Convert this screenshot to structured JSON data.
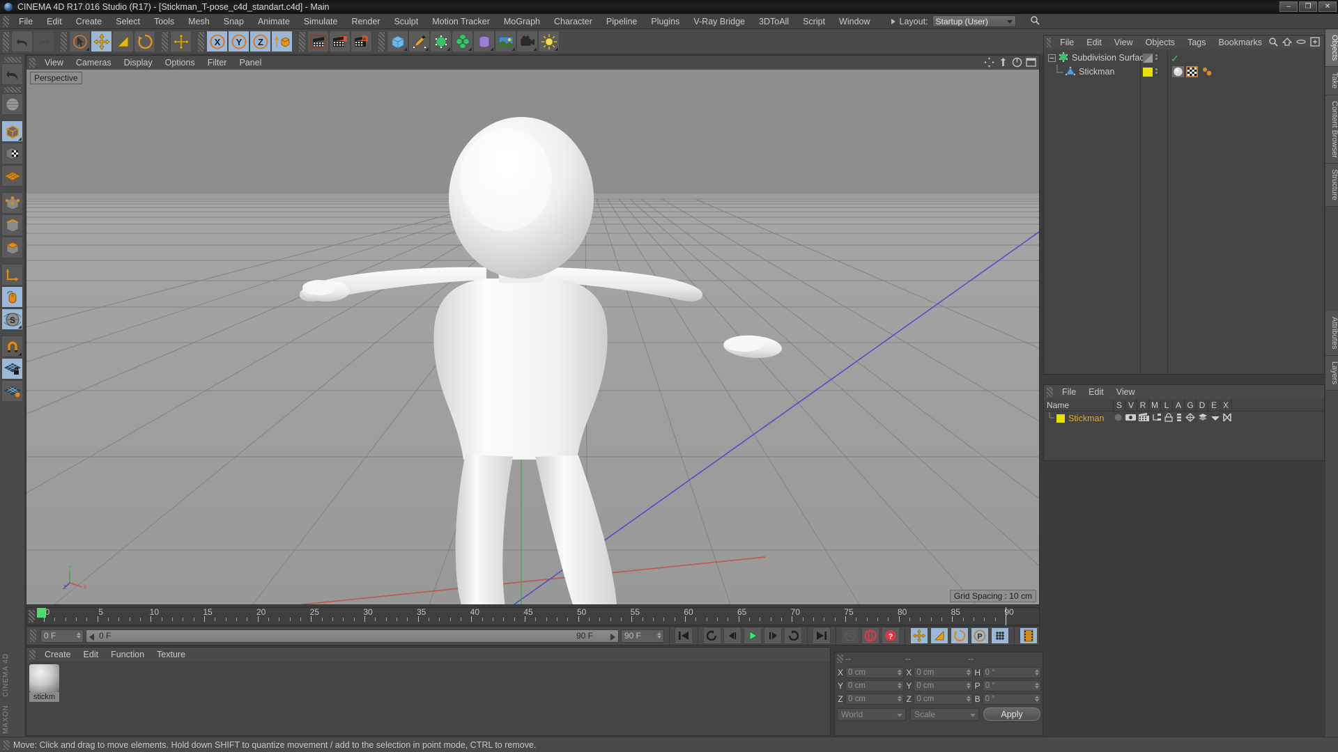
{
  "window": {
    "title": "CINEMA 4D R17.016 Studio (R17) - [Stickman_T-pose_c4d_standart.c4d] - Main",
    "minimize": "–",
    "maximize": "❐",
    "close": "✕"
  },
  "menubar": {
    "items": [
      "File",
      "Edit",
      "Create",
      "Select",
      "Tools",
      "Mesh",
      "Snap",
      "Animate",
      "Simulate",
      "Render",
      "Sculpt",
      "Motion Tracker",
      "MoGraph",
      "Character",
      "Pipeline",
      "Plugins",
      "V-Ray Bridge",
      "3DToAll",
      "Script",
      "Window"
    ],
    "layout_label": "Layout:",
    "layout_value": "Startup (User)"
  },
  "toolbar": {
    "groups": [
      {
        "buttons": [
          {
            "name": "undo-icon",
            "state": "normal"
          },
          {
            "name": "redo-icon",
            "state": "disabled"
          }
        ]
      },
      {
        "buttons": [
          {
            "name": "live-selection-icon",
            "state": "normal"
          },
          {
            "name": "move-tool-icon",
            "state": "selected"
          },
          {
            "name": "scale-tool-icon",
            "state": "normal"
          },
          {
            "name": "rotate-tool-icon",
            "state": "normal"
          }
        ]
      },
      {
        "buttons": [
          {
            "name": "move-axis-icon",
            "state": "normal"
          }
        ]
      },
      {
        "buttons": [
          {
            "name": "x-axis-lock-icon",
            "state": "selected"
          },
          {
            "name": "y-axis-lock-icon",
            "state": "selected"
          },
          {
            "name": "z-axis-lock-icon",
            "state": "selected"
          },
          {
            "name": "world-object-axis-icon",
            "state": "normal"
          }
        ]
      },
      {
        "buttons": [
          {
            "name": "render-view-icon",
            "state": "normal"
          },
          {
            "name": "render-to-picture-viewer-icon",
            "state": "normal"
          },
          {
            "name": "render-settings-icon",
            "state": "normal"
          }
        ]
      },
      {
        "buttons": [
          {
            "name": "cube-primitive-icon",
            "state": "normal"
          },
          {
            "name": "spline-pen-icon",
            "state": "normal"
          },
          {
            "name": "nurbs-generator-icon",
            "state": "normal"
          },
          {
            "name": "array-modeling-icon",
            "state": "normal"
          },
          {
            "name": "deformer-icon",
            "state": "normal"
          },
          {
            "name": "environment-icon",
            "state": "normal"
          },
          {
            "name": "camera-icon",
            "state": "normal"
          },
          {
            "name": "light-icon",
            "state": "normal"
          }
        ]
      }
    ]
  },
  "left_toolbar": {
    "buttons": [
      {
        "name": "undo-view-icon",
        "state": "normal"
      },
      {
        "name": "make-editable-icon",
        "state": "normal"
      },
      {
        "name": "model-mode-icon",
        "state": "selected"
      },
      {
        "name": "texture-mode-icon",
        "state": "normal"
      },
      {
        "name": "polygon-mode-icon",
        "state": "normal"
      },
      {
        "name": "point-mode-icon",
        "state": "normal"
      },
      {
        "name": "edge-mode-icon",
        "state": "normal"
      },
      {
        "name": "polygon-select-mode-icon",
        "state": "normal"
      },
      {
        "name": "world-axis-icon",
        "state": "normal"
      },
      {
        "name": "viewport-solo-icon",
        "state": "selected"
      },
      {
        "name": "sculpt-mode-icon",
        "state": "selected"
      },
      {
        "name": "snap-magnet-icon",
        "state": "normal"
      },
      {
        "name": "workplane-lock-icon",
        "state": "selected"
      },
      {
        "name": "workplane-icon",
        "state": "normal"
      }
    ],
    "brand_line1": "MAXON",
    "brand_line2": "CINEMA 4D"
  },
  "viewport": {
    "menu": [
      "View",
      "Cameras",
      "Display",
      "Options",
      "Filter",
      "Panel"
    ],
    "camera_label": "Perspective",
    "grid_spacing": "Grid Spacing : 10 cm",
    "axis_labels": {
      "x": "X",
      "y": "Y",
      "z": "Z"
    }
  },
  "timeline": {
    "start_frame": "0 F",
    "current_frame_field": "0 F",
    "end_frame_field": "90 F",
    "preview_end": "90 F",
    "right_frame_field": "0 F",
    "ticks": [
      0,
      5,
      10,
      15,
      20,
      25,
      30,
      35,
      40,
      45,
      50,
      55,
      60,
      65,
      70,
      75,
      80,
      85,
      90
    ],
    "transport_buttons": [
      {
        "name": "go-to-start-icon",
        "state": "normal"
      },
      {
        "name": "play-backwards-icon",
        "state": "normal"
      },
      {
        "name": "previous-frame-icon",
        "state": "normal"
      },
      {
        "name": "play-forward-icon",
        "state": "normal"
      },
      {
        "name": "next-frame-icon",
        "state": "normal"
      },
      {
        "name": "play-loop-icon",
        "state": "normal"
      },
      {
        "name": "go-to-end-icon",
        "state": "normal"
      },
      {
        "name": "autokey-icon",
        "state": "disabled"
      },
      {
        "name": "record-active-objects-icon",
        "state": "normal"
      },
      {
        "name": "keyframe-selection-icon",
        "state": "normal"
      },
      {
        "name": "record-position-icon",
        "state": "selected"
      },
      {
        "name": "record-scale-icon",
        "state": "selected"
      },
      {
        "name": "record-rotation-icon",
        "state": "selected"
      },
      {
        "name": "record-parameter-icon",
        "state": "selected"
      },
      {
        "name": "point-level-animation-icon",
        "state": "selected"
      },
      {
        "name": "timeline-toggle-icon",
        "state": "selected"
      }
    ]
  },
  "material_manager": {
    "menu": [
      "Create",
      "Edit",
      "Function",
      "Texture"
    ],
    "materials": [
      {
        "name": "stickman",
        "label": "stickm"
      }
    ]
  },
  "object_manager": {
    "menu": [
      "File",
      "Edit",
      "View",
      "Objects",
      "Tags",
      "Bookmarks"
    ],
    "header_icons": [
      "search-icon",
      "home-icon",
      "ellipse-icon",
      "new-view-icon"
    ],
    "objects": [
      {
        "name": "Subdivision Surface",
        "type": "subdivision-surface",
        "indent": 0,
        "expanded": true,
        "enabled": true,
        "dot_color": "#4bdc72",
        "tags": []
      },
      {
        "name": "Stickman",
        "type": "polygon-object",
        "indent": 1,
        "expanded": false,
        "enabled": true,
        "dot_color": "#66a7e0",
        "layer_color": "#e8e000",
        "tags": [
          "material-tag",
          "texture-tag",
          "point-tag"
        ]
      }
    ]
  },
  "layer_manager": {
    "menu": [
      "File",
      "Edit",
      "View"
    ],
    "columns": [
      "Name",
      "S",
      "V",
      "R",
      "M",
      "L",
      "A",
      "G",
      "D",
      "E",
      "X"
    ],
    "rows": [
      {
        "name": "Stickman",
        "color": "#e8e000"
      }
    ]
  },
  "coordinates": {
    "header_dashes": [
      "--",
      "--",
      "--"
    ],
    "position": {
      "label_x": "X",
      "label_y": "Y",
      "label_z": "Z",
      "x": "0 cm",
      "y": "0 cm",
      "z": "0 cm"
    },
    "size": {
      "label_x": "X",
      "label_y": "Y",
      "label_z": "Z",
      "x": "0 cm",
      "y": "0 cm",
      "z": "0 cm"
    },
    "rotation": {
      "label_h": "H",
      "label_p": "P",
      "label_b": "B",
      "h": "0 °",
      "p": "0 °",
      "b": "0 °"
    },
    "coord_system": "World",
    "size_mode": "Scale",
    "apply_label": "Apply"
  },
  "right_rail": {
    "tabs": [
      "Objects",
      "Take",
      "Content Browser",
      "Structure",
      "Attributes",
      "Layers"
    ]
  },
  "statusbar": {
    "message": "Move: Click and drag to move elements. Hold down SHIFT to quantize movement / add to the selection in point mode, CTRL to remove."
  },
  "colors": {
    "accent_orange": "#e08a1e",
    "selected_blue": "#9cb8d8",
    "panel_bg": "#444444",
    "toolbar_bg": "#4a4a4a",
    "viewport_bg": "#9a9a9a",
    "green_marker": "#4bdc72",
    "axis_x": "#d04040",
    "axis_y": "#3fb53f",
    "axis_z": "#4040d0"
  }
}
